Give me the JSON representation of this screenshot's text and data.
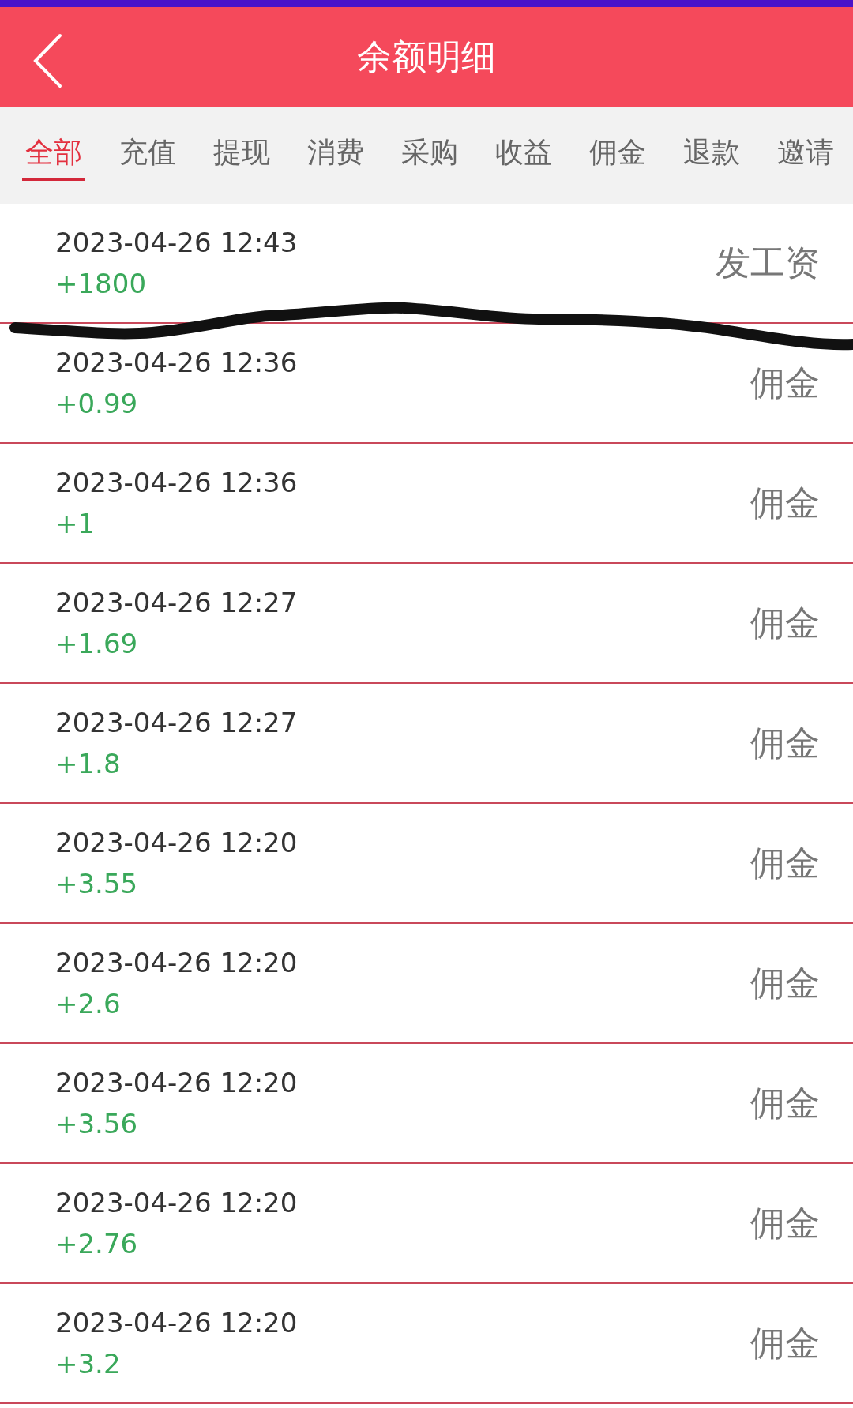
{
  "header": {
    "title": "余额明细"
  },
  "tabs": [
    {
      "label": "全部",
      "selected": true
    },
    {
      "label": "充值",
      "selected": false
    },
    {
      "label": "提现",
      "selected": false
    },
    {
      "label": "消费",
      "selected": false
    },
    {
      "label": "采购",
      "selected": false
    },
    {
      "label": "收益",
      "selected": false
    },
    {
      "label": "佣金",
      "selected": false
    },
    {
      "label": "退款",
      "selected": false
    },
    {
      "label": "邀请",
      "selected": false
    }
  ],
  "records": [
    {
      "time": "2023-04-26 12:43",
      "amount": "+1800",
      "type": "发工资"
    },
    {
      "time": "2023-04-26 12:36",
      "amount": "+0.99",
      "type": "佣金"
    },
    {
      "time": "2023-04-26 12:36",
      "amount": "+1",
      "type": "佣金"
    },
    {
      "time": "2023-04-26 12:27",
      "amount": "+1.69",
      "type": "佣金"
    },
    {
      "time": "2023-04-26 12:27",
      "amount": "+1.8",
      "type": "佣金"
    },
    {
      "time": "2023-04-26 12:20",
      "amount": "+3.55",
      "type": "佣金"
    },
    {
      "time": "2023-04-26 12:20",
      "amount": "+2.6",
      "type": "佣金"
    },
    {
      "time": "2023-04-26 12:20",
      "amount": "+3.56",
      "type": "佣金"
    },
    {
      "time": "2023-04-26 12:20",
      "amount": "+2.76",
      "type": "佣金"
    },
    {
      "time": "2023-04-26 12:20",
      "amount": "+3.2",
      "type": "佣金"
    }
  ]
}
